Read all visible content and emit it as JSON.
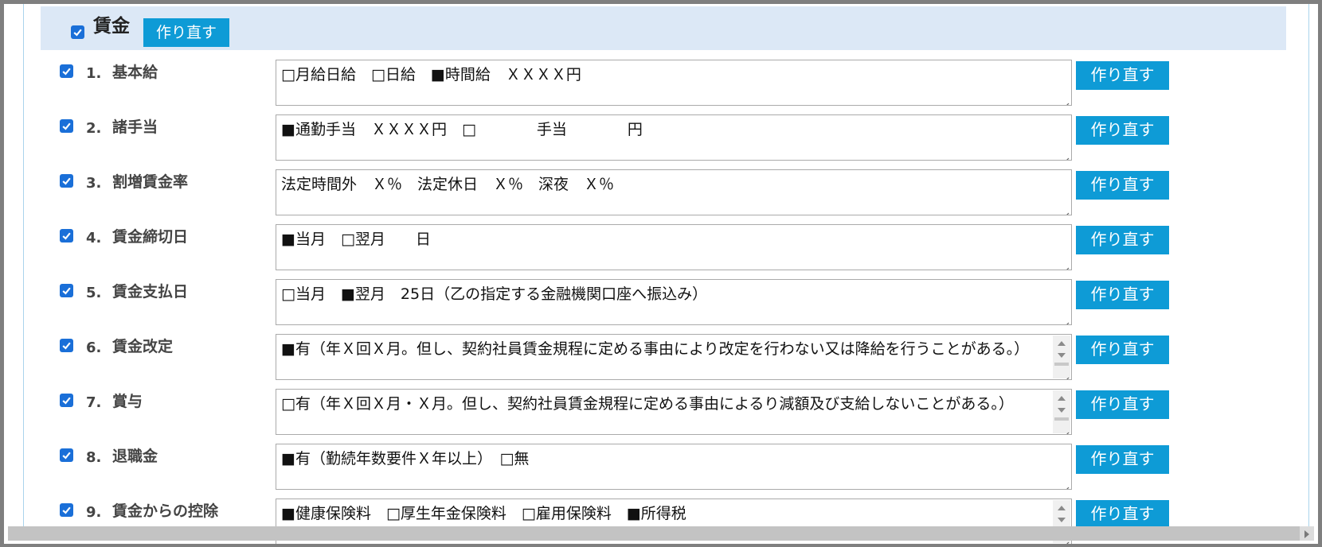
{
  "section": {
    "title": "賃金",
    "checked": true,
    "rebuild_label": "作り直す"
  },
  "rows": [
    {
      "num": "1.",
      "label": "基本給",
      "checked": true,
      "text": "□月給日給　□日給　■時間給　ＸＸＸＸ円",
      "scroll": false,
      "rebuild_label": "作り直す"
    },
    {
      "num": "2.",
      "label": "諸手当",
      "checked": true,
      "text": "■通勤手当　ＸＸＸＸ円　□　　　　手当　　　　円",
      "scroll": false,
      "rebuild_label": "作り直す"
    },
    {
      "num": "3.",
      "label": "割増賃金率",
      "checked": true,
      "text": "法定時間外　Ｘ％　法定休日　Ｘ％　深夜　Ｘ％",
      "scroll": false,
      "rebuild_label": "作り直す"
    },
    {
      "num": "4.",
      "label": "賃金締切日",
      "checked": true,
      "text": "■当月　□翌月　　日",
      "scroll": false,
      "rebuild_label": "作り直す"
    },
    {
      "num": "5.",
      "label": "賃金支払日",
      "checked": true,
      "text": "□当月　■翌月　25日（乙の指定する金融機関口座へ振込み）",
      "scroll": false,
      "rebuild_label": "作り直す"
    },
    {
      "num": "6.",
      "label": "賃金改定",
      "checked": true,
      "text": "■有（年Ｘ回Ｘ月。但し、契約社員賃金規程に定める事由により改定を行わない又は降給を行うことがある。）",
      "scroll": true,
      "rebuild_label": "作り直す"
    },
    {
      "num": "7.",
      "label": "賞与",
      "checked": true,
      "text": "□有（年Ｘ回Ｘ月・Ｘ月。但し、契約社員賃金規程に定める事由によるり減額及び支給しないことがある。）",
      "scroll": true,
      "rebuild_label": "作り直す"
    },
    {
      "num": "8.",
      "label": "退職金",
      "checked": true,
      "text": "■有（勤続年数要件Ｘ年以上）　□無",
      "scroll": false,
      "rebuild_label": "作り直す"
    },
    {
      "num": "9.",
      "label": "賃金からの控除",
      "checked": true,
      "text": "■健康保険料　□厚生年金保険料　□雇用保険料　■所得税",
      "scroll": true,
      "rebuild_label": "作り直す"
    }
  ]
}
